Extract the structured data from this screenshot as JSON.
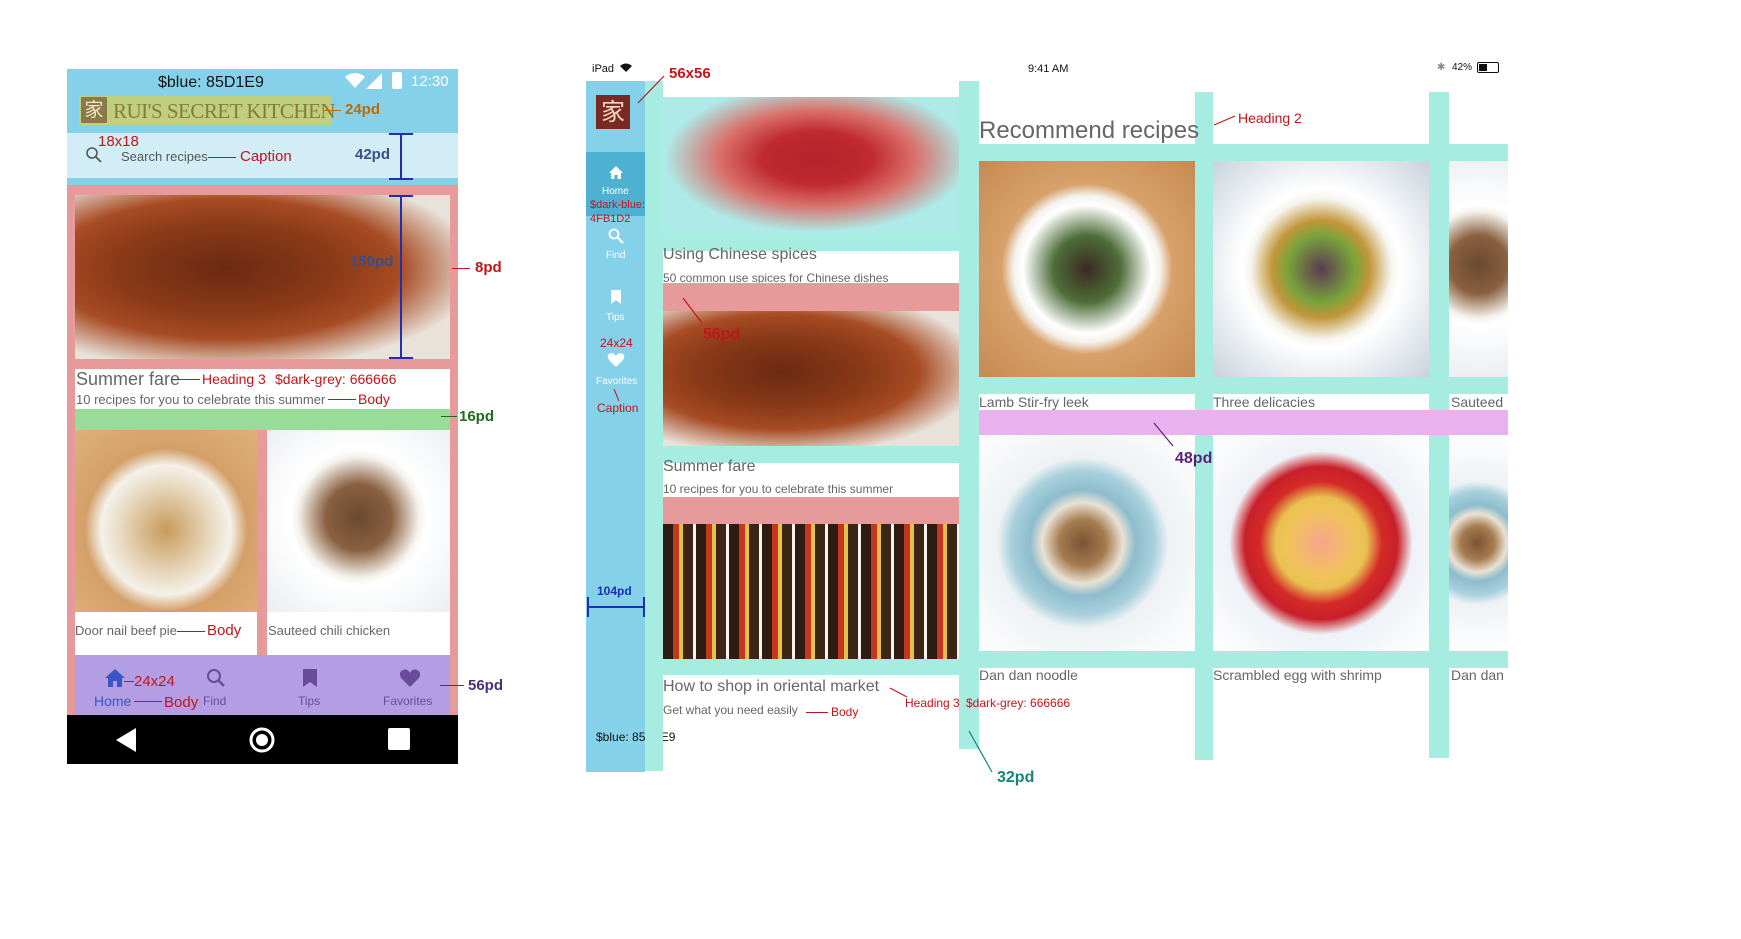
{
  "colors": {
    "blue": "#85D1E9",
    "dark_blue": "#4FB1D2",
    "dark_grey": "#666666",
    "annotation_red": "#c0161b",
    "spacing_teal": "#a7ece1",
    "spacing_pink": "#e79a9a",
    "spacing_green": "#98dc99",
    "spacing_purple": "#e9b2ee",
    "nav_purple": "#b49ee3"
  },
  "phone": {
    "status_label": "$blue: 85D1E9",
    "status_time": "12:30",
    "app_title": "RUI'S SECRET KITCHEN",
    "logo_glyph": "家",
    "search_placeholder": "Search recipes",
    "featured": {
      "title": "Summer fare",
      "subtitle": "10 recipes for you to celebrate this summer"
    },
    "cards": [
      {
        "title": "Door nail beef pie"
      },
      {
        "title": "Sauteed chili chicken"
      }
    ],
    "nav": [
      {
        "label": "Home",
        "icon": "home-icon"
      },
      {
        "label": "Find",
        "icon": "search-icon"
      },
      {
        "label": "Tips",
        "icon": "bookmark-icon"
      },
      {
        "label": "Favorites",
        "icon": "heart-icon"
      }
    ]
  },
  "phone_annotations": {
    "title_pad": "24pd",
    "icon_size": "18x18",
    "caption": "Caption",
    "search_height": "42pd",
    "image_height": "150pd",
    "side_pad": "8pd",
    "heading3": "Heading 3",
    "dark_grey": "$dark-grey: 666666",
    "body": "Body",
    "gap": "16pd",
    "body2": "Body",
    "nav_icon_size": "24x24",
    "body3": "Body",
    "nav_height": "56pd"
  },
  "tablet": {
    "device": "iPad",
    "time": "9:41 AM",
    "battery": "42%",
    "logo_glyph": "家",
    "rail": [
      {
        "label": "Home",
        "icon": "home-icon"
      },
      {
        "label": "Find",
        "icon": "search-icon"
      },
      {
        "label": "Tips",
        "icon": "bookmark-icon"
      },
      {
        "label": "Favorites",
        "icon": "heart-icon"
      }
    ],
    "rail_blue": "$blue: 85D1E9",
    "feed": [
      {
        "title": "Using Chinese spices",
        "subtitle": "50 common use spices for Chinese dishes"
      },
      {
        "title": "Summer fare",
        "subtitle": "10 recipes for you to celebrate this summer"
      },
      {
        "title": "How to shop in oriental market",
        "subtitle": "Get what you need easily"
      }
    ],
    "section_title": "Recommend recipes",
    "recipes_row1": [
      "Lamb Stir-fry leek",
      "Three delicacies",
      "Sauteed"
    ],
    "recipes_row2": [
      "Dan dan noodle",
      "Scrambled egg with shrimp",
      "Dan dan"
    ]
  },
  "tablet_annotations": {
    "logo_size": "56x56",
    "dark_blue": "$dark-blue: 4FB1D2",
    "icon_size": "24x24",
    "caption": "Caption",
    "rail_width": "104pd",
    "feed_gap": "56pd",
    "heading3": "Heading 3",
    "dark_grey": "$dark-grey: 666666",
    "body": "Body",
    "gutter": "32pd",
    "heading2": "Heading 2",
    "row_gap": "48pd"
  }
}
